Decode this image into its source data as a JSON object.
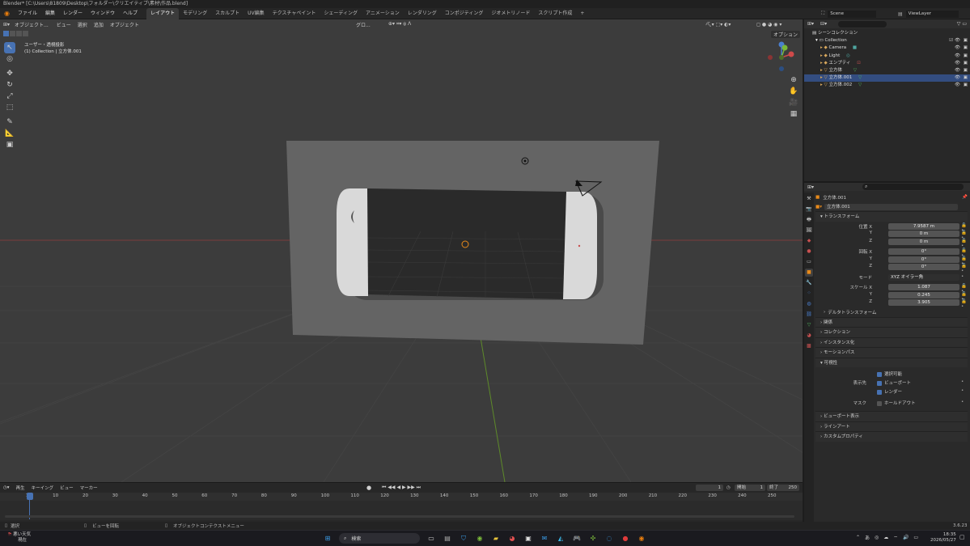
{
  "titlebar": {
    "title": "Blender* [C:\\Users\\81809\\Desktop\\フォルダー\\クリエイティブ\\素材\\作品.blend]"
  },
  "menu": [
    "ファイル",
    "編集",
    "レンダー",
    "ウィンドウ",
    "ヘルプ"
  ],
  "workspaces": [
    "レイアウト",
    "モデリング",
    "スカルプト",
    "UV編集",
    "テクスチャペイント",
    "シェーディング",
    "アニメーション",
    "レンダリング",
    "コンポジティング",
    "ジオメトリノード",
    "スクリプト作成"
  ],
  "scene": {
    "label": "Scene",
    "viewlayer": "ViewLayer"
  },
  "viewport": {
    "mode": "オブジェクト...",
    "menus": [
      "ビュー",
      "選択",
      "追加",
      "オブジェクト"
    ],
    "transform_orientation": "グロ...",
    "options_label": "オプション",
    "overlay_title": "ユーザー・透視投影",
    "overlay_subtitle": "(1) Collection | 立方体.001"
  },
  "outliner": {
    "scene_collection": "シーンコレクション",
    "collection": "Collection",
    "items": [
      {
        "name": "Camera",
        "icon": "camera-icon",
        "color": "#d8a85d"
      },
      {
        "name": "Light",
        "icon": "light-icon",
        "color": "#d8a85d"
      },
      {
        "name": "エンプティ",
        "icon": "empty-icon",
        "color": "#d8a85d"
      },
      {
        "name": "立方体",
        "icon": "mesh-icon",
        "color": "#d8a85d"
      },
      {
        "name": "立方体.001",
        "icon": "mesh-icon",
        "color": "#d8a85d"
      },
      {
        "name": "立方体.002",
        "icon": "mesh-icon",
        "color": "#d8a85d"
      }
    ]
  },
  "properties": {
    "object_name": "立方体.001",
    "data_name": "立方体.001",
    "transform_label": "トランスフォーム",
    "location_label": "位置 X",
    "location": [
      "7.9587 m",
      "0 m",
      "0 m"
    ],
    "rotation_label": "回転 X",
    "rotation": [
      "0°",
      "0°",
      "0°"
    ],
    "mode_label": "モード",
    "mode_value": "XYZ オイラー角",
    "scale_label": "スケール X",
    "scale": [
      "1.087",
      "0.245",
      "3.905"
    ],
    "axis_y": "Y",
    "axis_z": "Z",
    "delta_label": "デルタトランスフォーム",
    "panels_a": [
      "関係",
      "コレクション",
      "インスタンス化",
      "モーションパス"
    ],
    "visibility_label": "可視性",
    "selectable": "選択可能",
    "show_in_label": "表示先",
    "viewport_cb": "ビューポート",
    "render_cb": "レンダー",
    "mask_label": "マスク",
    "holdout": "ホールドアウト",
    "panels_b": [
      "ビューポート表示",
      "ラインアート",
      "カスタムプロパティ"
    ]
  },
  "timeline": {
    "menus": [
      "再生",
      "キーイング",
      "ビュー",
      "マーカー"
    ],
    "current_frame": "1",
    "start_label": "開始",
    "start": "1",
    "end_label": "終了",
    "end": "250",
    "ticks": [
      "1",
      "10",
      "20",
      "30",
      "40",
      "50",
      "60",
      "70",
      "80",
      "90",
      "100",
      "110",
      "120",
      "130",
      "140",
      "150",
      "160",
      "170",
      "180",
      "190",
      "200",
      "210",
      "220",
      "230",
      "240",
      "250"
    ]
  },
  "statusbar": {
    "select": "選択",
    "rotate": "ビューを回転",
    "context": "オブジェクトコンテクストメニュー",
    "version": "3.6.23"
  },
  "taskbar": {
    "weather_line1": "悪い天気",
    "weather_line2": "現在",
    "search": "検索",
    "ime": "あ",
    "time": "18:35",
    "date": "2026/05/27"
  }
}
